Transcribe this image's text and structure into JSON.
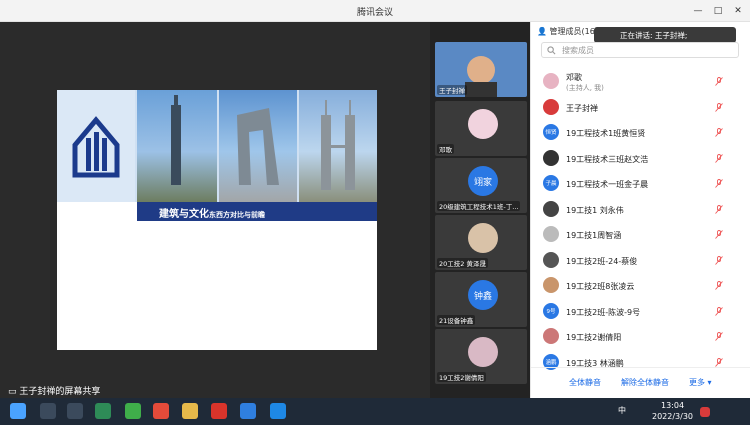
{
  "window": {
    "title": "腾讯会议",
    "minimize": "—",
    "maximize": "□",
    "close": "✕"
  },
  "stage": {
    "slide_title": "建筑与文化",
    "slide_subtitle": "东西方对比与前瞻",
    "share_label": "王子封禅的屏幕共享"
  },
  "tiles": [
    {
      "name": "王子封禅"
    },
    {
      "name": "邓歌"
    },
    {
      "name": "20级建筑工程技术1班-丁...",
      "avatar_text": "翊家",
      "color": "#2a78e4"
    },
    {
      "name": "20工技2 黄泽晟"
    },
    {
      "name": "21设备钟鑫",
      "avatar_text": "钟鑫",
      "color": "#2a78e4"
    },
    {
      "name": "19工技2谢倩阳"
    }
  ],
  "panel": {
    "header": "管理成员(167)",
    "speaking": "正在讲话: 王子封禅;",
    "search_placeholder": "搜索成员",
    "members": [
      {
        "name": "邓歌",
        "sub": "(主持人, 我)",
        "color": "#e7b3c2"
      },
      {
        "name": "王子封禅",
        "sub": "",
        "color": "#d83b3b"
      },
      {
        "name": "19工程技术1班黄恒贤",
        "sub": "",
        "color": "#2a78e4",
        "avatar_text": "恒贤"
      },
      {
        "name": "19工程技术三班赵文浩",
        "sub": "",
        "color": "#333"
      },
      {
        "name": "19工程技术一班金子晨",
        "sub": "",
        "color": "#2a78e4",
        "avatar_text": "子晨"
      },
      {
        "name": "19工技1 刘永伟",
        "sub": "",
        "color": "#444"
      },
      {
        "name": "19工技1周智涵",
        "sub": "",
        "color": "#bbb"
      },
      {
        "name": "19工技2班-24-蔡俊",
        "sub": "",
        "color": "#555"
      },
      {
        "name": "19工技2班8张凌云",
        "sub": "",
        "color": "#c9956b"
      },
      {
        "name": "19工技2班-陈波-9号",
        "sub": "",
        "color": "#2a78e4",
        "avatar_text": "9号"
      },
      {
        "name": "19工技2谢倩阳",
        "sub": "",
        "color": "#c77"
      },
      {
        "name": "19工技3 林涵鹏",
        "sub": "",
        "color": "#2a78e4",
        "avatar_text": "涵鹏"
      }
    ],
    "footer": {
      "mute_all": "全体静音",
      "unmute_all": "解除全体静音",
      "more": "更多 ▾"
    }
  },
  "taskbar": {
    "time": "13:04",
    "date": "2022/3/30",
    "ime": "中"
  },
  "colors": {
    "accent": "#1a6ae6",
    "taskbar": "#1f2a38",
    "stage_bg": "#2b2b2b",
    "slide_band": "#1f3b86"
  }
}
